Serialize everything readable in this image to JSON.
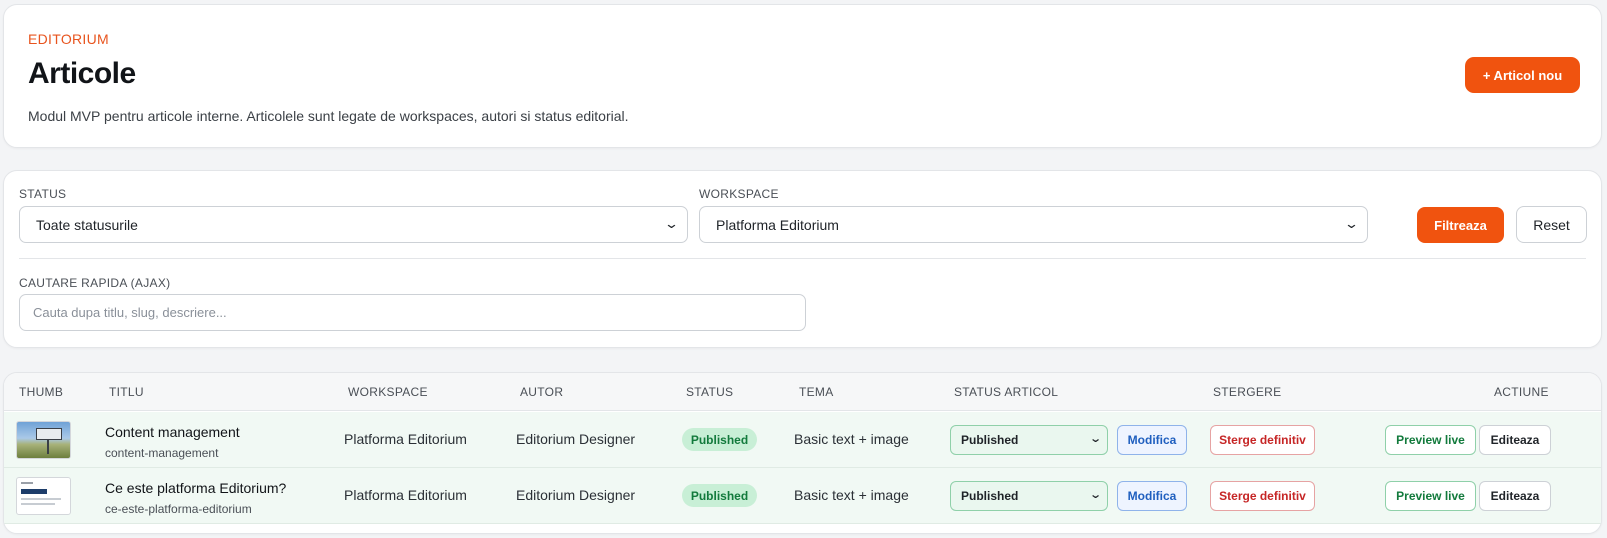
{
  "header": {
    "eyebrow": "EDITORIUM",
    "title": "Articole",
    "description": "Modul MVP pentru articole interne. Articolele sunt legate de workspaces, autori si status editorial.",
    "new_button": "+ Articol nou"
  },
  "filters": {
    "status_label": "STATUS",
    "status_value": "Toate statusurile",
    "workspace_label": "WORKSPACE",
    "workspace_value": "Platforma Editorium",
    "filter_button": "Filtreaza",
    "reset_button": "Reset",
    "search_label": "CAUTARE RAPIDA (AJAX)",
    "search_placeholder": "Cauta dupa titlu, slug, descriere..."
  },
  "table": {
    "columns": {
      "thumb": "THUMB",
      "title": "TITLU",
      "workspace": "WORKSPACE",
      "author": "AUTOR",
      "status": "STATUS",
      "theme": "TEMA",
      "article_status": "STATUS ARTICOL",
      "delete": "STERGERE",
      "action": "ACTIUNE"
    },
    "rows": [
      {
        "title": "Content management",
        "slug": "content-management",
        "workspace": "Platforma Editorium",
        "author": "Editorium Designer",
        "status": "Published",
        "theme": "Basic text + image",
        "article_status": "Published",
        "modify": "Modifica",
        "delete": "Sterge definitiv",
        "preview": "Preview live",
        "edit": "Editeaza"
      },
      {
        "title": "Ce este platforma Editorium?",
        "slug": "ce-este-platforma-editorium",
        "workspace": "Platforma Editorium",
        "author": "Editorium Designer",
        "status": "Published",
        "theme": "Basic text + image",
        "article_status": "Published",
        "modify": "Modifica",
        "delete": "Sterge definitiv",
        "preview": "Preview live",
        "edit": "Editeaza"
      }
    ]
  },
  "colors": {
    "accent": "#f0530f",
    "published_bg": "#c8efd6",
    "published_text": "#127a3c",
    "danger": "#c62626",
    "info": "#1f5fbf"
  },
  "icons": [
    "chevron-down-icon"
  ]
}
